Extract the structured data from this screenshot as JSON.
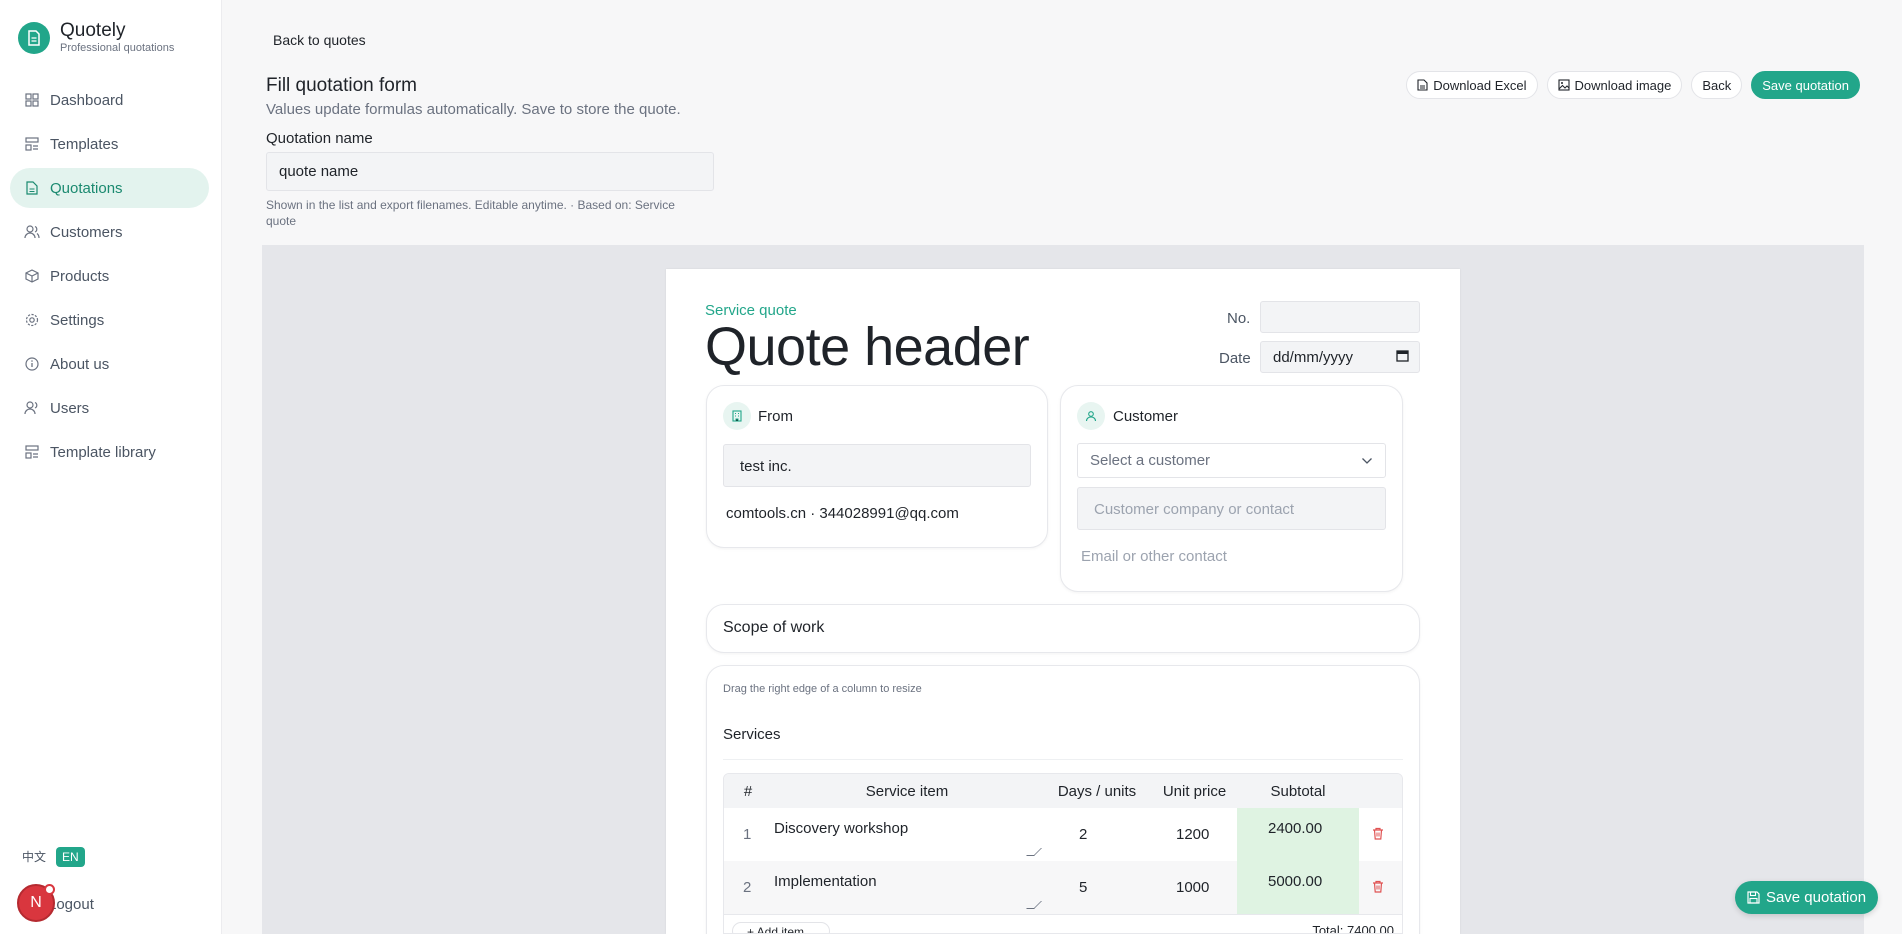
{
  "brand": {
    "name": "Quotely",
    "subtitle": "Professional quotations"
  },
  "sidebar": {
    "items": [
      {
        "label": "Dashboard",
        "icon": "dashboard-icon"
      },
      {
        "label": "Templates",
        "icon": "templates-icon"
      },
      {
        "label": "Quotations",
        "icon": "document-icon",
        "active": true
      },
      {
        "label": "Customers",
        "icon": "users-icon"
      },
      {
        "label": "Products",
        "icon": "box-icon"
      },
      {
        "label": "Settings",
        "icon": "gear-icon"
      },
      {
        "label": "About us",
        "icon": "info-icon"
      },
      {
        "label": "Users",
        "icon": "user-icon"
      },
      {
        "label": "Template library",
        "icon": "library-icon"
      }
    ],
    "lang_zh": "中文",
    "lang_en": "EN",
    "avatar_initial": "N",
    "logout": "Logout"
  },
  "header": {
    "back_link": "Back to quotes",
    "title": "Fill quotation form",
    "subtitle": "Values update formulas automatically. Save to store the quote.",
    "quotation_name_label": "Quotation name",
    "quotation_name_value": "quote name",
    "quotation_name_help": "Shown in the list and export filenames. Editable anytime. · Based on: Service quote"
  },
  "toolbar": {
    "download_excel": "Download Excel",
    "download_image": "Download image",
    "back": "Back",
    "save": "Save quotation"
  },
  "quote": {
    "tag": "Service quote",
    "header": "Quote header",
    "no_label": "No.",
    "no_value": "",
    "date_label": "Date",
    "date_placeholder": "dd/mm/yyyy",
    "from": {
      "title": "From",
      "company": "test inc.",
      "contact": "comtools.cn · 344028991@qq.com"
    },
    "customer": {
      "title": "Customer",
      "select_placeholder": "Select a customer",
      "company_placeholder": "Customer company or contact",
      "email_placeholder": "Email or other contact"
    },
    "scope_title": "Scope of work",
    "drag_hint": "Drag the right edge of a column to resize",
    "services_title": "Services",
    "table": {
      "columns": [
        "#",
        "Service item",
        "Days / units",
        "Unit price",
        "Subtotal"
      ],
      "rows": [
        {
          "no": "1",
          "item": "Discovery workshop",
          "units": "2",
          "price": "1200",
          "subtotal": "2400.00"
        },
        {
          "no": "2",
          "item": "Implementation",
          "units": "5",
          "price": "1000",
          "subtotal": "5000.00"
        }
      ],
      "add_item": "+ Add item",
      "total": "Total: 7400.00"
    }
  },
  "float_save": "Save quotation",
  "colors": {
    "accent": "#22a68a",
    "subtotal_bg": "#dff3e2",
    "canvas": "#e5e6ea"
  }
}
